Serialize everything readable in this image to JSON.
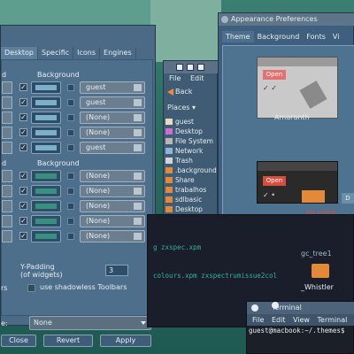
{
  "prefs_window": {
    "tabs": [
      "Desktop",
      "Specific",
      "Icons",
      "Engines"
    ],
    "active_tab": "Desktop",
    "headers": {
      "col1": "d",
      "col2": "Background"
    },
    "rows_top": [
      "guest",
      "guest",
      "(None)",
      "(None)",
      "guest"
    ],
    "rows_bottom": [
      "(None)",
      "(None)",
      "(None)",
      "(None)",
      "(None)"
    ],
    "ypad_label_1": "Y-Padding",
    "ypad_label_2": "(of widgets)",
    "ypad_value": "3",
    "rs_label": "rs",
    "shadowless_label": "use shadowless Toolbars",
    "theme_label": "e:",
    "theme_value": "None",
    "buttons": {
      "close": "Close",
      "revert": "Revert",
      "apply": "Apply"
    }
  },
  "file_window": {
    "menu": [
      "File",
      "Edit"
    ],
    "back_label": "Back",
    "places_label": "Places",
    "places": [
      {
        "name": "guest",
        "color": "#e8dcc0"
      },
      {
        "name": "Desktop",
        "color": "#d06bd0"
      },
      {
        "name": "File System",
        "color": "#b7b7b7"
      },
      {
        "name": "Network",
        "color": "#8fb3d9"
      },
      {
        "name": "Trash",
        "color": "#cfd5dc"
      },
      {
        "name": ".backgrounds",
        "color": "#e28a3a"
      },
      {
        "name": "Share",
        "color": "#e28a3a"
      },
      {
        "name": "trabalhos",
        "color": "#e28a3a"
      },
      {
        "name": "sdlbasic",
        "color": "#e28a3a"
      },
      {
        "name": "Desktop",
        "color": "#e28a3a"
      }
    ]
  },
  "appearance_window": {
    "title": "Appearance Preferences",
    "tabs": [
      "Theme",
      "Background",
      "Fonts",
      "Vi"
    ],
    "active_tab": "Theme",
    "theme_name": "Amaranth",
    "open_label_1": "Open",
    "open_label_2": "Open",
    "d_button": "D",
    "link_text": "Ins online"
  },
  "middle_terminal": {
    "line1": "g zxspec.xpm",
    "line2": "colours.xpm zxspectrumissue2col",
    "gc_label": "gc_tree1",
    "whistler_label": "_Whistler"
  },
  "terminal": {
    "title": "Terminal",
    "menu": [
      "File",
      "Edit",
      "View",
      "Terminal"
    ],
    "prompt": "guest@macbook:~/.themes$"
  },
  "colors": {
    "desktop": "#2f6a5f",
    "window_bg": "#4a6a86",
    "accent_orange": "#e28a3a",
    "terminal_text": "#36b0a0",
    "link_red": "#d8503a"
  }
}
